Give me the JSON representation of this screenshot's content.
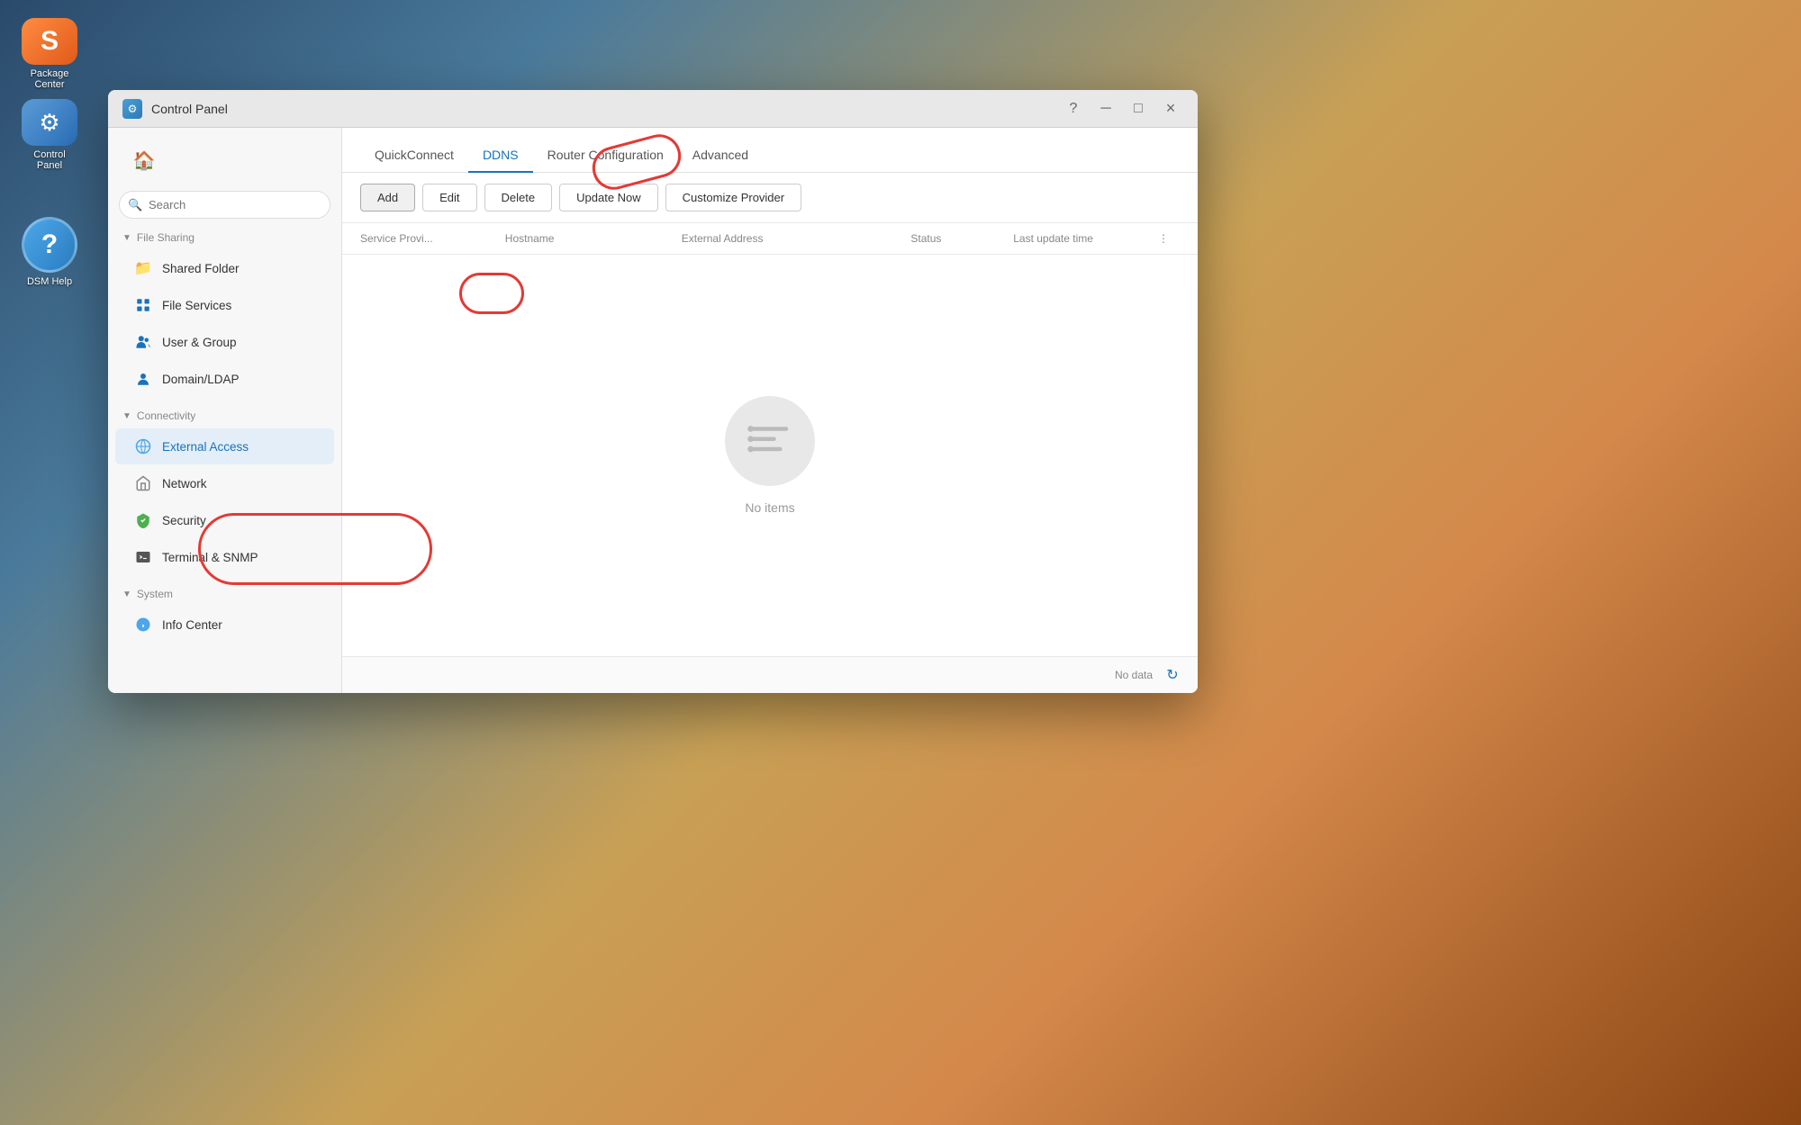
{
  "desktop": {
    "bg_color": "#4a7a9b"
  },
  "dock": {
    "items": [
      {
        "id": "synology-s",
        "icon": "S",
        "label": "Package\nCenter",
        "bg": "#ff6b35"
      },
      {
        "id": "mixer",
        "icon": "⚙",
        "label": "Control\nPanel",
        "bg": "#5b9bd5"
      },
      {
        "id": "dsm-help",
        "icon": "?",
        "label": "DSM Help",
        "bg": "#4da6e8"
      }
    ]
  },
  "control_panel": {
    "title": "Control Panel",
    "tabs": [
      {
        "id": "quickconnect",
        "label": "QuickConnect",
        "active": false
      },
      {
        "id": "ddns",
        "label": "DDNS",
        "active": true
      },
      {
        "id": "router",
        "label": "Router Configuration",
        "active": false
      },
      {
        "id": "advanced",
        "label": "Advanced",
        "active": false
      }
    ],
    "toolbar": {
      "add": "Add",
      "edit": "Edit",
      "delete": "Delete",
      "update_now": "Update Now",
      "customize_provider": "Customize Provider"
    },
    "table": {
      "columns": [
        {
          "id": "service",
          "label": "Service Provi..."
        },
        {
          "id": "hostname",
          "label": "Hostname"
        },
        {
          "id": "external",
          "label": "External Address"
        },
        {
          "id": "status",
          "label": "Status"
        },
        {
          "id": "updated",
          "label": "Last update time"
        }
      ],
      "rows": []
    },
    "empty_state": {
      "text": "No items"
    },
    "footer": {
      "no_data": "No data"
    }
  },
  "sidebar": {
    "search_placeholder": "Search",
    "home_icon": "🏠",
    "sections": [
      {
        "id": "file-sharing",
        "label": "File Sharing",
        "expanded": true,
        "items": [
          {
            "id": "shared-folder",
            "label": "Shared Folder",
            "icon": "📁"
          },
          {
            "id": "file-services",
            "label": "File Services",
            "icon": "📋"
          },
          {
            "id": "user-group",
            "label": "User & Group",
            "icon": "👥"
          },
          {
            "id": "domain-ldap",
            "label": "Domain/LDAP",
            "icon": "👤"
          }
        ]
      },
      {
        "id": "connectivity",
        "label": "Connectivity",
        "expanded": true,
        "items": [
          {
            "id": "external-access",
            "label": "External Access",
            "icon": "🌐",
            "active": true
          },
          {
            "id": "network",
            "label": "Network",
            "icon": "🏠"
          },
          {
            "id": "security",
            "label": "Security",
            "icon": "🛡"
          },
          {
            "id": "terminal-snmp",
            "label": "Terminal & SNMP",
            "icon": "⬛"
          }
        ]
      },
      {
        "id": "system",
        "label": "System",
        "expanded": true,
        "items": [
          {
            "id": "info-center",
            "label": "Info Center",
            "icon": "ℹ"
          }
        ]
      }
    ]
  }
}
